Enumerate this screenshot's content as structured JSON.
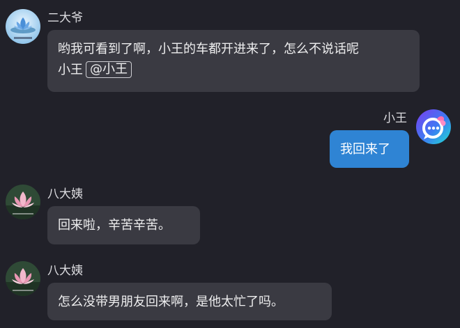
{
  "messages": [
    {
      "sender": "二大爷",
      "avatar_icon": "lotus-avatar-icon",
      "side": "left",
      "text": "哟我可看到了啊，小王的车都开进来了，怎么不说话呢",
      "text_line2": "小王",
      "mention": "@小王"
    },
    {
      "sender": "小王",
      "avatar_icon": "chat-bubble-avatar-icon",
      "side": "right",
      "text": "我回来了"
    },
    {
      "sender": "八大姨",
      "avatar_icon": "pink-lotus-avatar-icon",
      "side": "left",
      "text": "回来啦，辛苦辛苦。"
    },
    {
      "sender": "八大姨",
      "avatar_icon": "pink-lotus-avatar-icon",
      "side": "left",
      "text": "怎么没带男朋友回来啊，是他太忙了吗。"
    }
  ],
  "colors": {
    "background": "#212129",
    "bubble_other": "#3a3a42",
    "bubble_mine": "#2f84d4"
  }
}
